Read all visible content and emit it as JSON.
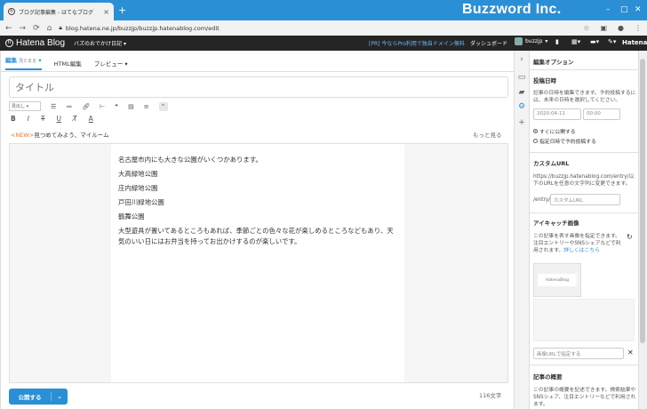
{
  "browser": {
    "tab_title": "ブログ記事編集 - はてなブログ",
    "tab_favicon": "hatena-icon",
    "url": "blog.hatena.ne.jp/buzzjp/buzzjp.hatenablog.com/edit",
    "brand": "Buzzword Inc."
  },
  "hatena_bar": {
    "logo": "Hatena Blog",
    "blog_name": "バズのおでかけ日記",
    "pro_link": "[PR] 今ならPro利用で独自ドメイン無料",
    "dashboard": "ダッシュボード",
    "user": "buzzjp",
    "hatena": "Hatena"
  },
  "editor": {
    "mode_tabs": [
      {
        "label": "編集",
        "sub": "見たまま"
      },
      {
        "label": "HTML編集"
      },
      {
        "label": "プレビュー"
      }
    ],
    "title_placeholder": "タイトル",
    "heading_select": "見出し",
    "news_tag": "<NEW>",
    "news_text": "見つめてみよう、マイルーム",
    "more": "もっと見る",
    "body": [
      "名古屋市内にも大きな公園がいくつかあります。",
      "大高緑地公園",
      "庄内緑地公園",
      "戸田川緑地公園",
      "鶴舞公園"
    ],
    "body_paragraph": "大型遊具が置いてあるところもあれば、季節ごとの色々な花が楽しめるところなどもあり、天気のいい日にはお弁当を持ってお出かけするのが楽しいです。",
    "publish_label": "公開する",
    "char_count": "116文字"
  },
  "side": {
    "header": "編集オプション",
    "post_date": {
      "title": "投稿日時",
      "desc": "記事の日時を編集できます。予約投稿するには、未来の日時を選択してください。",
      "date": "2020-04-11",
      "time": "00:00",
      "opt_now": "すぐに公開する",
      "opt_scheduled": "指定日時で予約投稿する"
    },
    "custom_url": {
      "title": "カスタムURL",
      "desc": "https://buzzjp.hatenablog.com/entry/以下のURLを任意の文字列に変更できます。",
      "prefix": "/entry/",
      "placeholder": "カスタムURL"
    },
    "eyecatch": {
      "title": "アイキャッチ画像",
      "desc": "この記事を表す画像を指定できます。注目エントリーやSNSシェアなどで利用されます。",
      "link": "詳しくはこちら",
      "thumb_text": "HatenaBlog",
      "url_placeholder": "画像URLで指定する"
    },
    "summary": {
      "title": "記事の概要",
      "desc": "この記事の概要を記述できます。検索結果やSNSシェア、注目エントリーなどで利用されます。"
    }
  }
}
